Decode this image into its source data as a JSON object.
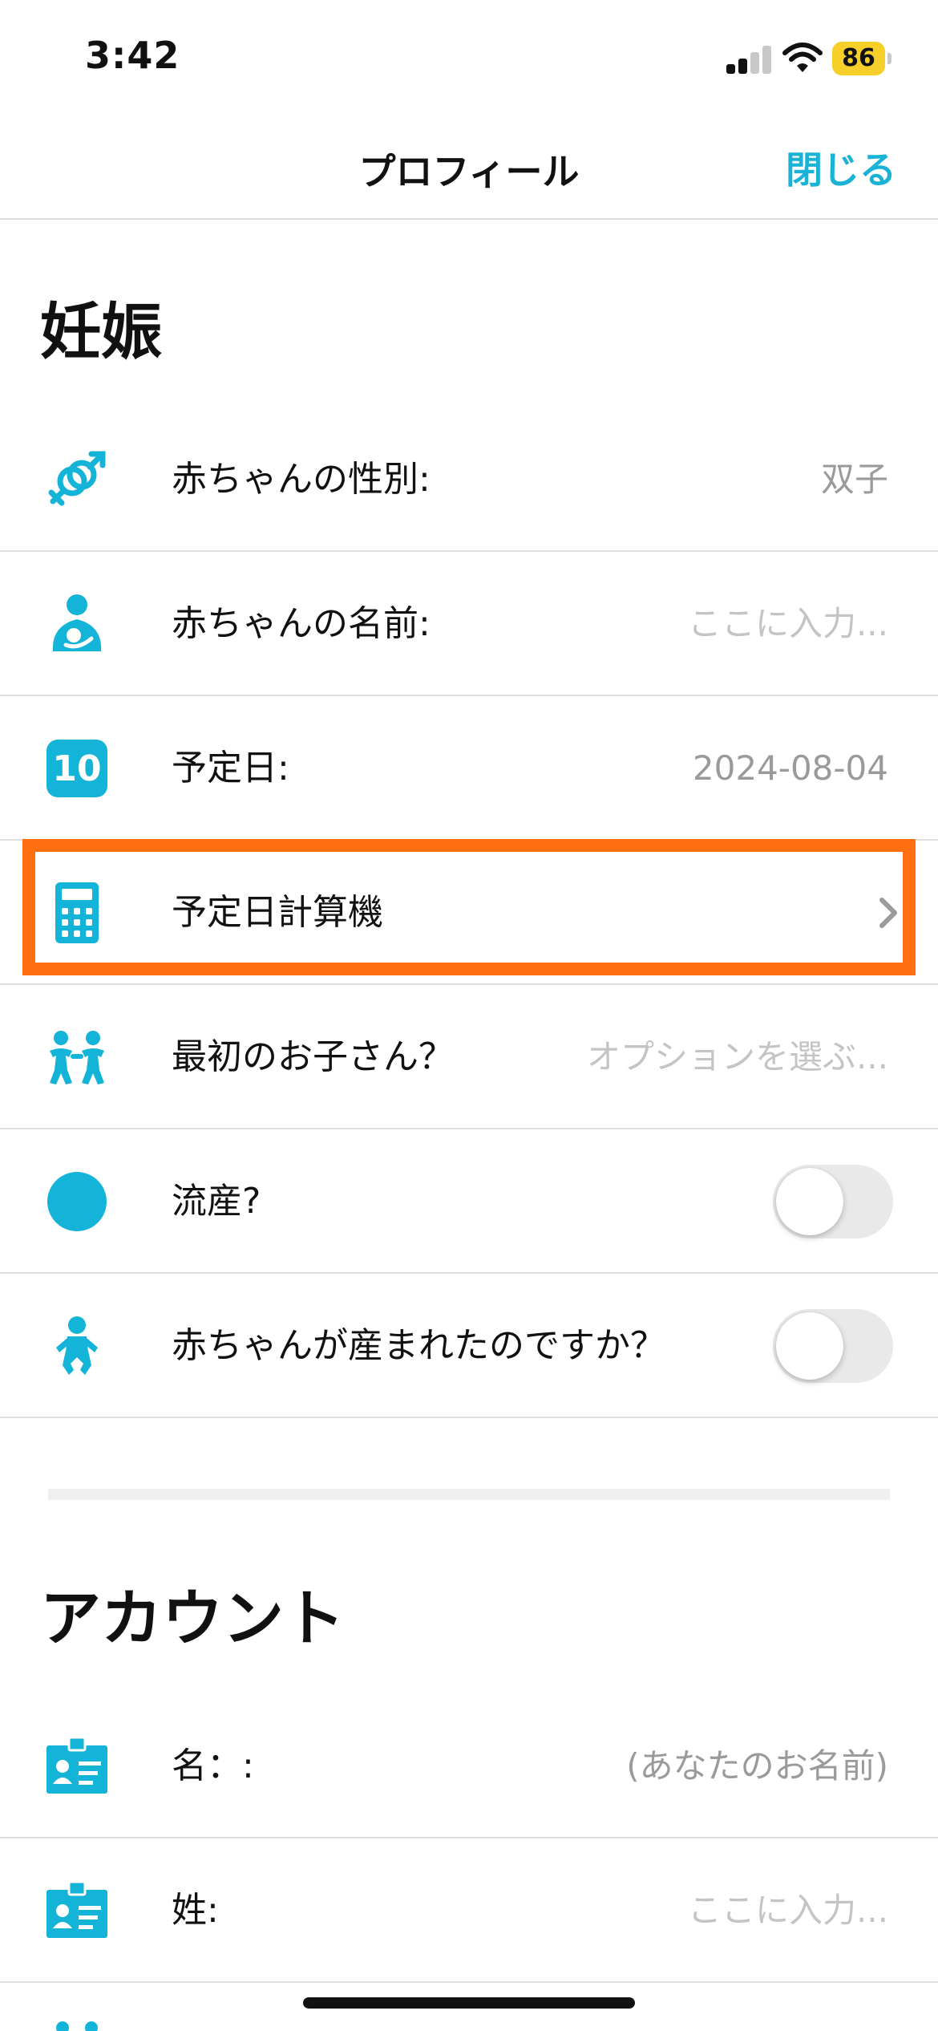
{
  "status_bar": {
    "time": "3:42",
    "battery_level": "86",
    "signal_bars_active": 2,
    "signal_bars_total": 4,
    "battery_color": "#f7cf2a",
    "icons": [
      "cellular-signal-icon",
      "wifi-icon",
      "battery-icon"
    ]
  },
  "nav": {
    "title": "プロフィール",
    "close_label": "閉じる",
    "accent_color": "#1ab3d6"
  },
  "pregnancy": {
    "title": "妊娠",
    "rows": [
      {
        "label": "赤ちゃんの性別:",
        "value": "双子",
        "icon": "gender-icon"
      },
      {
        "label": "赤ちゃんの名前:",
        "value": "ここに入力...",
        "icon": "mother-baby-icon"
      },
      {
        "label": "予定日:",
        "value": "2024-08-04",
        "icon": "calendar-icon",
        "icon_text": "10"
      },
      {
        "label": "予定日計算機",
        "icon": "calculator-icon"
      },
      {
        "label": "最初のお子さん？",
        "value": "オプションを選ぶ...",
        "icon": "children-icon"
      },
      {
        "label": "流産?",
        "toggle": false,
        "icon": "circle-icon"
      },
      {
        "label": "赤ちゃんが産まれたのですか？",
        "toggle": false,
        "icon": "baby-icon"
      }
    ]
  },
  "account": {
    "title": "アカウント",
    "rows": [
      {
        "label": "名：:",
        "value": "(あなたのお名前)",
        "icon": "id-card-icon"
      },
      {
        "label": "姓:",
        "value": "ここに入力...",
        "icon": "id-card-icon"
      }
    ]
  },
  "highlight_color": "#ff6f0f"
}
